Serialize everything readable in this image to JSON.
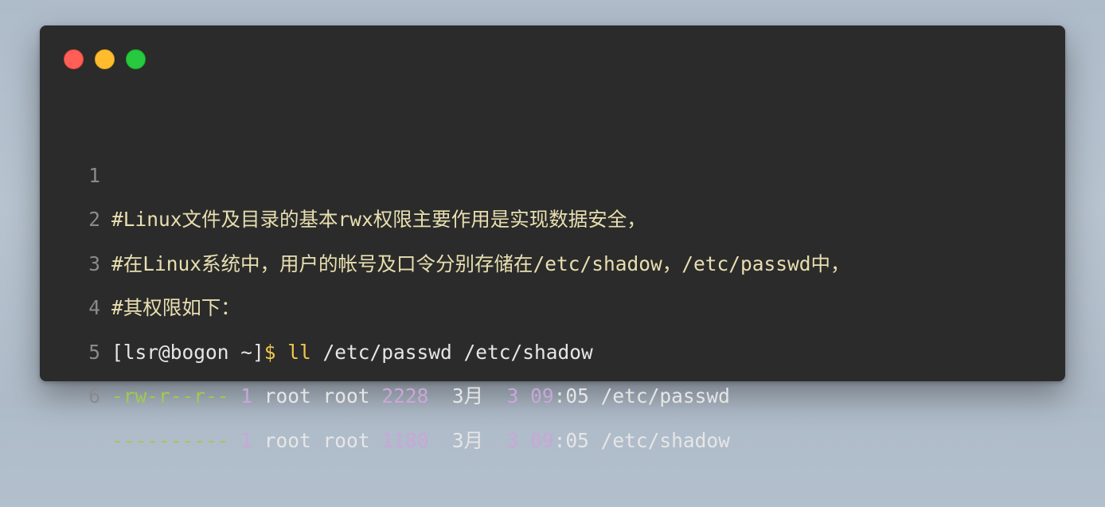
{
  "window": {
    "traffic_lights": [
      {
        "name": "close",
        "color": "#ff5f56",
        "border": "#e0443e"
      },
      {
        "name": "minimize",
        "color": "#ffbd2e",
        "border": "#dea123"
      },
      {
        "name": "maximize",
        "color": "#27c93f",
        "border": "#1aab29"
      }
    ]
  },
  "colors": {
    "comment": "#e8dfb0",
    "prompt": "#e6e6e6",
    "command": "#f2c94c",
    "permission": "#9ecb4d",
    "number": "#c9a6d8",
    "text": "#e6e6e6",
    "line_number": "#8a8a8a"
  },
  "lines": [
    {
      "num": "1",
      "segments": [
        {
          "text": "#Linux文件及目录的基本rwx权限主要作用是实现数据安全，",
          "type": "comment"
        }
      ]
    },
    {
      "num": "2",
      "segments": [
        {
          "text": "#在Linux系统中，用户的帐号及口令分别存储在/etc/shadow，/etc/passwd中，",
          "type": "comment"
        }
      ]
    },
    {
      "num": "3",
      "segments": [
        {
          "text": "#其权限如下：",
          "type": "comment"
        }
      ]
    },
    {
      "num": "4",
      "segments": [
        {
          "text": "[lsr@bogon ~]",
          "type": "prompt"
        },
        {
          "text": "$ ll",
          "type": "command"
        },
        {
          "text": " /etc/passwd /etc/shadow",
          "type": "text"
        }
      ]
    },
    {
      "num": "5",
      "segments": [
        {
          "text": "-rw-r--r--",
          "type": "permission"
        },
        {
          "text": " ",
          "type": "text"
        },
        {
          "text": "1",
          "type": "number"
        },
        {
          "text": " root root ",
          "type": "text"
        },
        {
          "text": "2228",
          "type": "number"
        },
        {
          "text": "  3月  ",
          "type": "text"
        },
        {
          "text": "3",
          "type": "number"
        },
        {
          "text": " ",
          "type": "text"
        },
        {
          "text": "09",
          "type": "number"
        },
        {
          "text": ":05 /etc/passwd",
          "type": "text"
        }
      ]
    },
    {
      "num": "6",
      "segments": [
        {
          "text": "----------",
          "type": "permission"
        },
        {
          "text": " ",
          "type": "text"
        },
        {
          "text": "1",
          "type": "number"
        },
        {
          "text": " root root ",
          "type": "text"
        },
        {
          "text": "1180",
          "type": "number"
        },
        {
          "text": "  3月  ",
          "type": "text"
        },
        {
          "text": "3",
          "type": "number"
        },
        {
          "text": " ",
          "type": "text"
        },
        {
          "text": "09",
          "type": "number"
        },
        {
          "text": ":05 /etc/shadow",
          "type": "text"
        }
      ]
    }
  ]
}
